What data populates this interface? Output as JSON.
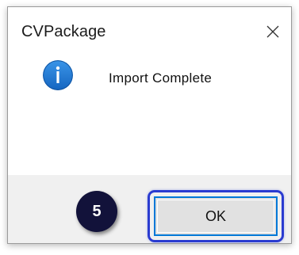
{
  "dialog": {
    "title": "CVPackage",
    "message": "Import Complete",
    "ok_label": "OK"
  },
  "annotation": {
    "step_number": "5",
    "highlight_color": "#2a3bd0",
    "badge_color": "#12123a"
  },
  "icons": {
    "close": "close-icon",
    "info": "info-icon"
  },
  "colors": {
    "info_icon": "#1b7ad4",
    "button_focus_border": "#0078d7"
  }
}
